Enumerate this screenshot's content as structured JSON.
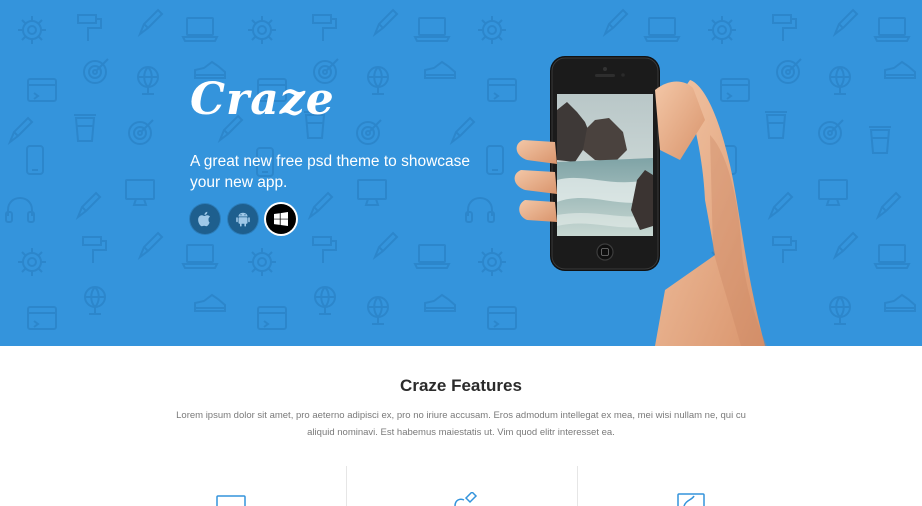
{
  "hero": {
    "brand": "Craze",
    "tagline": "A great new free psd theme to showcase your new app.",
    "background_color": "#3494dc",
    "platforms": [
      {
        "name": "apple",
        "icon": "apple-icon",
        "active": false
      },
      {
        "name": "android",
        "icon": "android-icon",
        "active": false
      },
      {
        "name": "windows",
        "icon": "windows-icon",
        "active": true
      }
    ],
    "pattern_icons": [
      "gear-icon",
      "paint-roller-icon",
      "laptop-icon",
      "pen-icon",
      "globe-icon",
      "shoe-icon",
      "browser-window-icon",
      "target-icon",
      "smartphone-icon",
      "monitor-icon",
      "headphones-icon",
      "coffee-cup-icon"
    ]
  },
  "features": {
    "title": "Craze Features",
    "description": "Lorem ipsum dolor sit amet, pro aeterno adipisci ex, pro no iriure accusam. Eros admodum intellegat ex mea, mei wisi nullam ne, qui cu aliquid nominavi. Est habemus maiestatis ut. Vim quod elitr interesset ea.",
    "icons": [
      "screen-icon",
      "pen-tool-icon",
      "image-icon"
    ]
  }
}
